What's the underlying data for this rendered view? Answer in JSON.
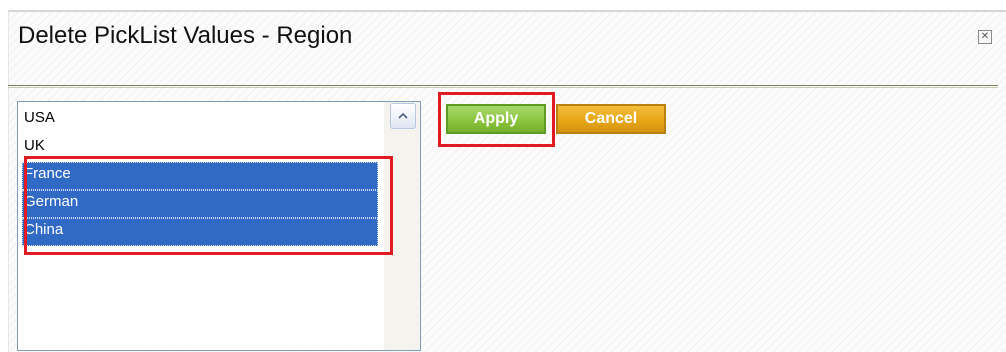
{
  "dialog": {
    "title": "Delete PickList Values - Region",
    "close_icon": "close-icon"
  },
  "picklist": {
    "items": [
      {
        "label": "USA",
        "selected": false
      },
      {
        "label": "UK",
        "selected": false
      },
      {
        "label": "France",
        "selected": true
      },
      {
        "label": "German",
        "selected": true
      },
      {
        "label": "China",
        "selected": true
      }
    ],
    "scroll_icon": "chevron-up-icon"
  },
  "actions": {
    "apply_label": "Apply",
    "cancel_label": "Cancel"
  },
  "colors": {
    "selection": "#316ac5",
    "apply": "#8cc63f",
    "cancel": "#e8a717",
    "annotation": "#e11b22"
  }
}
